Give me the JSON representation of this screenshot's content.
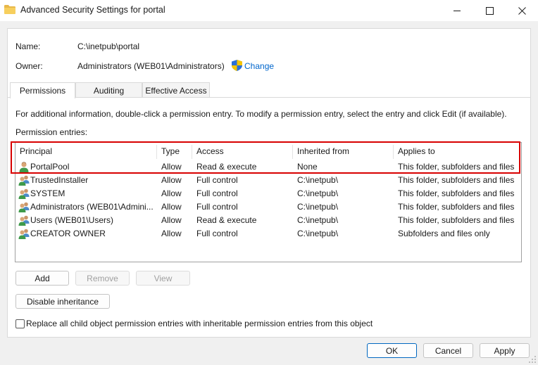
{
  "window": {
    "title": "Advanced Security Settings for portal",
    "folder_icon": "folder-icon"
  },
  "object": {
    "name_label": "Name:",
    "name_value": "C:\\inetpub\\portal",
    "owner_label": "Owner:",
    "owner_value": "Administrators (WEB01\\Administrators)",
    "change_label": "Change",
    "shield_icon": "uac-shield-icon"
  },
  "tabs": [
    {
      "label": "Permissions",
      "active": true
    },
    {
      "label": "Auditing",
      "active": false
    },
    {
      "label": "Effective Access",
      "active": false
    }
  ],
  "info_text": "For additional information, double-click a permission entry. To modify a permission entry, select the entry and click Edit (if available).",
  "entries_label": "Permission entries:",
  "columns": [
    "Principal",
    "Type",
    "Access",
    "Inherited from",
    "Applies to"
  ],
  "entries": [
    {
      "principal": "PortalPool",
      "type": "Allow",
      "access": "Read & execute",
      "inherited_from": "None",
      "applies_to": "This folder, subfolders and files",
      "icon": "user-icon"
    },
    {
      "principal": "TrustedInstaller",
      "type": "Allow",
      "access": "Full control",
      "inherited_from": "C:\\inetpub\\",
      "applies_to": "This folder, subfolders and files",
      "icon": "group-icon"
    },
    {
      "principal": "SYSTEM",
      "type": "Allow",
      "access": "Full control",
      "inherited_from": "C:\\inetpub\\",
      "applies_to": "This folder, subfolders and files",
      "icon": "group-icon"
    },
    {
      "principal": "Administrators (WEB01\\Admini...",
      "type": "Allow",
      "access": "Full control",
      "inherited_from": "C:\\inetpub\\",
      "applies_to": "This folder, subfolders and files",
      "icon": "group-icon"
    },
    {
      "principal": "Users (WEB01\\Users)",
      "type": "Allow",
      "access": "Read & execute",
      "inherited_from": "C:\\inetpub\\",
      "applies_to": "This folder, subfolders and files",
      "icon": "group-icon"
    },
    {
      "principal": "CREATOR OWNER",
      "type": "Allow",
      "access": "Full control",
      "inherited_from": "C:\\inetpub\\",
      "applies_to": "Subfolders and files only",
      "icon": "group-icon"
    }
  ],
  "buttons": {
    "add": "Add",
    "remove": "Remove",
    "view": "View",
    "disable_inheritance": "Disable inheritance",
    "ok": "OK",
    "cancel": "Cancel",
    "apply": "Apply"
  },
  "replace_checkbox": {
    "label": "Replace all child object permission entries with inheritable permission entries from this object",
    "checked": false
  },
  "colors": {
    "highlight": "#d80000",
    "link": "#0066cc",
    "primary_border": "#0067c0"
  }
}
